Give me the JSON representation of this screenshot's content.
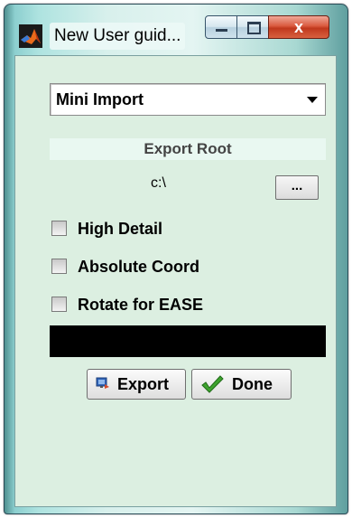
{
  "window": {
    "title": "New User guid...",
    "close_glyph": "x",
    "icon": "matlab-logo-icon"
  },
  "controls": {
    "minimize_icon": "minimize-icon",
    "maximize_icon": "maximize-icon",
    "close_icon": "close-icon"
  },
  "popup": {
    "selected": "Mini Import",
    "icon": "dropdown-arrow-icon"
  },
  "export_root": {
    "header": "Export Root",
    "path": "c:\\",
    "browse_label": "..."
  },
  "options": [
    {
      "label": "High Detail",
      "checked": false
    },
    {
      "label": "Absolute Coord",
      "checked": false
    },
    {
      "label": "Rotate for EASE",
      "checked": false
    }
  ],
  "status": {
    "text": "",
    "background": "#000000"
  },
  "buttons": {
    "export_label": "Export",
    "export_icon": "export-icon",
    "done_label": "Done",
    "done_icon": "checkmark-icon"
  },
  "colors": {
    "panel_background": "#dcefe1",
    "header_background": "#e9f8f1",
    "close_button": "#c8442a",
    "checkmark": "#3ea32e"
  }
}
